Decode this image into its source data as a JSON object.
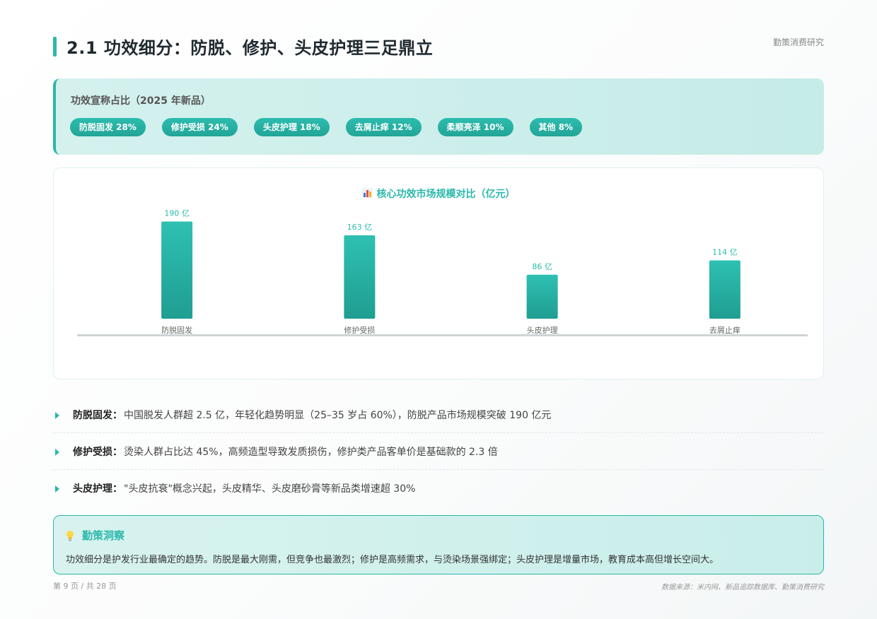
{
  "header": {
    "title": "2.1 功效细分：防脱、修护、头皮护理三足鼎立",
    "brand": "勤策消费研究"
  },
  "claims": {
    "title": "功效宣称占比（2025 年新品）",
    "items": [
      {
        "label": "防脱固发 28%"
      },
      {
        "label": "修护受损 24%"
      },
      {
        "label": "头皮护理 18%"
      },
      {
        "label": "去屑止痒 12%"
      },
      {
        "label": "柔顺亮泽 10%"
      },
      {
        "label": "其他 8%"
      }
    ]
  },
  "chart": {
    "icon": "bar-chart-icon",
    "title": "核心功效市场规模对比（亿元）"
  },
  "chart_data": {
    "type": "bar",
    "title": "核心功效市场规模对比（亿元）",
    "categories": [
      "防脱固发",
      "修护受损",
      "头皮护理",
      "去屑止痒"
    ],
    "values": [
      190,
      163,
      86,
      114
    ],
    "value_labels": [
      "190 亿",
      "163 亿",
      "86 亿",
      "114 亿"
    ],
    "ylim": [
      0,
      210
    ],
    "grid": false,
    "legend": "none",
    "bar_color_top": "#2ec0b2",
    "bar_color_bottom": "#1f9e91",
    "label_color": "#2bb8ab"
  },
  "points": [
    {
      "label": "防脱固发",
      "sep": "：",
      "text": "中国脱发人群超 2.5 亿，年轻化趋势明显（25–35 岁占 60%），防脱产品市场规模突破 190 亿元"
    },
    {
      "label": "修护受损",
      "sep": "：",
      "text": "烫染人群占比达 45%，高频造型导致发质损伤，修护类产品客单价是基础款的 2.3 倍"
    },
    {
      "label": "头皮护理",
      "sep": "：",
      "text": "\"头皮抗衰\"概念兴起，头皮精华、头皮磨砂膏等新品类增速超 30%"
    }
  ],
  "insight": {
    "icon": "lightbulb-icon",
    "title": "勤策洞察",
    "text": "功效细分是护发行业最确定的趋势。防脱是最大刚需，但竞争也最激烈；修护是高频需求，与烫染场景强绑定；头皮护理是增量市场，教育成本高但增长空间大。"
  },
  "footer": {
    "page": "第 9 页 / 共 28 页",
    "source": "数据来源：米内网、新品追踪数据库、勤策消费研究"
  },
  "colors": {
    "accent": "#2bb8ab",
    "panel_bg": "#cdeeea"
  }
}
